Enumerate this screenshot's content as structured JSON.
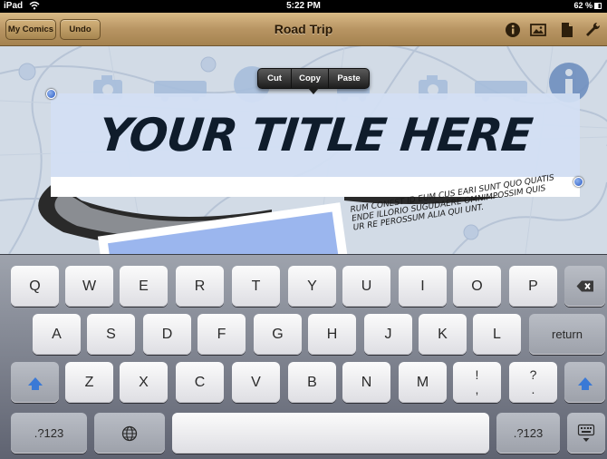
{
  "status_bar": {
    "device": "iPad",
    "wifi_icon": "wifi-icon",
    "time": "5:22 PM",
    "battery": "62 %"
  },
  "navbar": {
    "title": "Road Trip",
    "left_buttons": [
      "My Comics",
      "Undo"
    ],
    "right_icons": [
      "info-icon",
      "image-icon",
      "page-icon",
      "wrench-icon"
    ]
  },
  "canvas": {
    "title_text": "YOUR TITLE HERE",
    "caption_text": "RUM CONEST ID EUM CUS EARI SUNT QUO QUATIS ENDE ILLORIO SUGUDAERE OMNIMPOSSIM QUIS UR RE PEROSSUM ALIA QUI UNT.",
    "background_icons": [
      "camera-icon",
      "bus-icon",
      "info-icon",
      "car-icon"
    ]
  },
  "edit_menu": {
    "items": [
      "Cut",
      "Copy",
      "Paste"
    ]
  },
  "keyboard": {
    "row1": [
      "Q",
      "W",
      "E",
      "R",
      "T",
      "Y",
      "U",
      "I",
      "O",
      "P"
    ],
    "row2": [
      "A",
      "S",
      "D",
      "F",
      "G",
      "H",
      "J",
      "K",
      "L"
    ],
    "row3": [
      "Z",
      "X",
      "C",
      "V",
      "B",
      "N",
      "M"
    ],
    "row3_punct": [
      {
        "top": "!",
        "bottom": ","
      },
      {
        "top": "?",
        "bottom": "."
      }
    ],
    "return_label": "return",
    "numbers_label": ".?123",
    "icons": [
      "delete-icon",
      "shift-icon",
      "globe-icon",
      "keyboard-dismiss-icon"
    ]
  },
  "colors": {
    "navbar_accent": "#b89563",
    "selection_handle": "#2b5bc4",
    "shift_blue": "#3a79d6"
  }
}
